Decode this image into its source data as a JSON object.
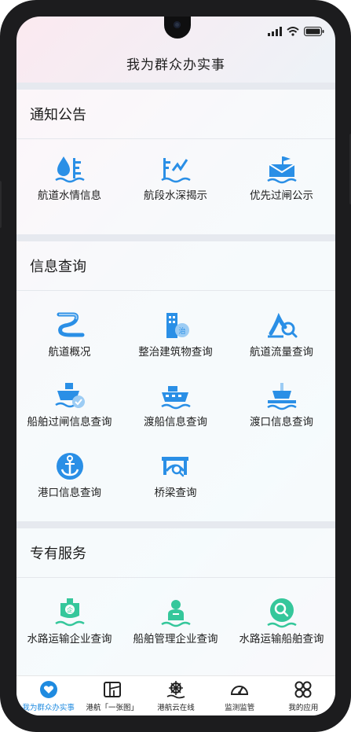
{
  "header": {
    "title": "我为群众办实事"
  },
  "sections": [
    {
      "title": "通知公告",
      "items": [
        {
          "label": "航道水情信息",
          "icon": "water-level-icon"
        },
        {
          "label": "航段水深揭示",
          "icon": "water-depth-icon"
        },
        {
          "label": "优先过闸公示",
          "icon": "lock-gate-flag-icon"
        }
      ]
    },
    {
      "title": "信息查询",
      "items": [
        {
          "label": "航道概况",
          "icon": "waterway-icon"
        },
        {
          "label": "整治建筑物查询",
          "icon": "building-icon"
        },
        {
          "label": "航道流量查询",
          "icon": "flow-search-icon"
        },
        {
          "label": "船舶过闸信息查询",
          "icon": "ship-check-icon"
        },
        {
          "label": "渡船信息查询",
          "icon": "ferry-icon"
        },
        {
          "label": "渡口信息查询",
          "icon": "ferry-port-icon"
        },
        {
          "label": "港口信息查询",
          "icon": "anchor-icon"
        },
        {
          "label": "桥梁查询",
          "icon": "bridge-search-icon"
        }
      ]
    },
    {
      "title": "专有服务",
      "items": [
        {
          "label": "水路运输企业查询",
          "icon": "enterprise-ship-icon"
        },
        {
          "label": "船舶管理企业查询",
          "icon": "ship-manage-icon"
        },
        {
          "label": "水路运输船舶查询",
          "icon": "ship-search-icon"
        }
      ]
    }
  ],
  "tabs": [
    {
      "label": "我为群众办实事",
      "icon": "heart-hand-icon",
      "active": true
    },
    {
      "label": "港航「一张图」",
      "icon": "map-icon",
      "active": false
    },
    {
      "label": "港航云在线",
      "icon": "ship-wheel-icon",
      "active": false
    },
    {
      "label": "监测监管",
      "icon": "gauge-icon",
      "active": false
    },
    {
      "label": "我的应用",
      "icon": "apps-icon",
      "active": false
    }
  ],
  "colors": {
    "blue": "#2a8fe6",
    "green": "#35c79b",
    "active": "#1f8be0"
  }
}
